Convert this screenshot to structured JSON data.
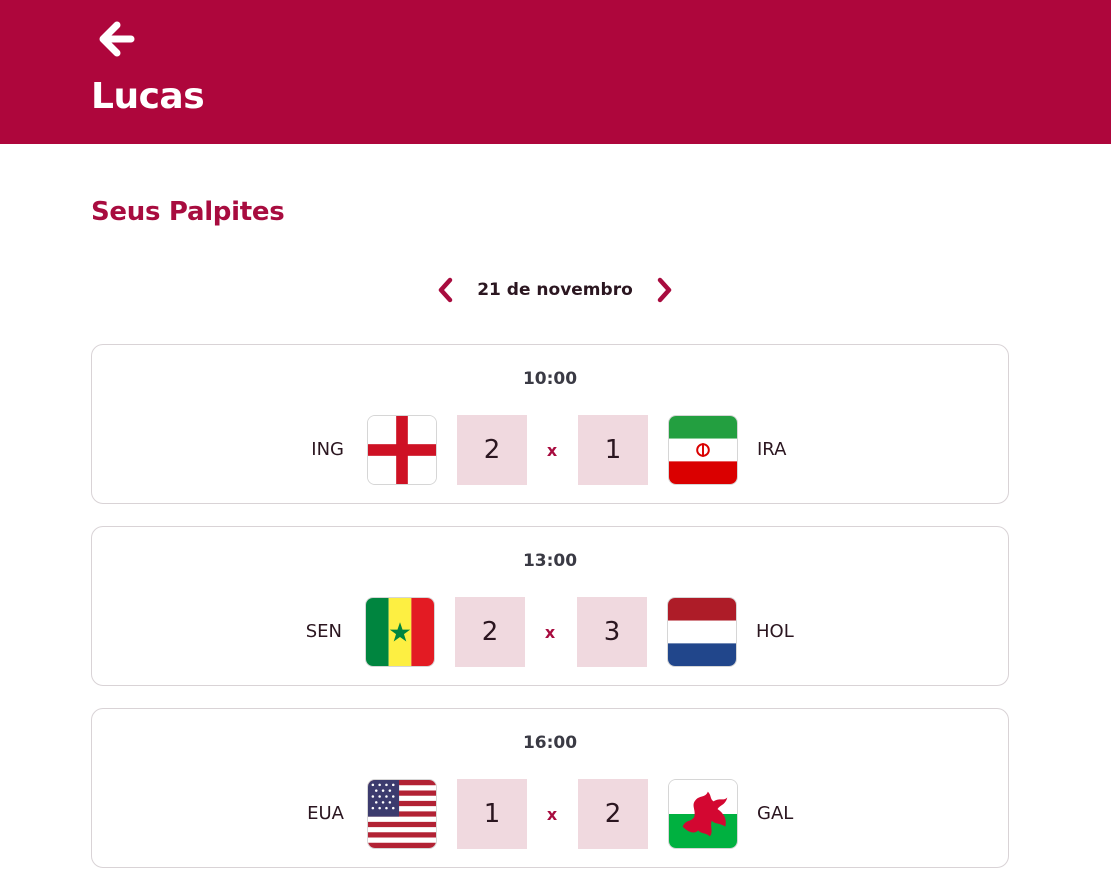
{
  "header": {
    "back_icon": "arrow-left-icon",
    "title": "Lucas"
  },
  "section": {
    "title": "Seus Palpites"
  },
  "date_nav": {
    "prev_icon": "chevron-left-icon",
    "next_icon": "chevron-right-icon",
    "label": "21 de novembro"
  },
  "colors": {
    "brand": "#ae063c",
    "score_bg": "#f0d9df",
    "accent_text": "#a80c3f"
  },
  "matches": [
    {
      "time": "10:00",
      "home": {
        "code": "ING",
        "flag": "england-flag-icon",
        "score": "2"
      },
      "versus": "x",
      "away": {
        "code": "IRA",
        "flag": "iran-flag-icon",
        "score": "1"
      }
    },
    {
      "time": "13:00",
      "home": {
        "code": "SEN",
        "flag": "senegal-flag-icon",
        "score": "2"
      },
      "versus": "x",
      "away": {
        "code": "HOL",
        "flag": "netherlands-flag-icon",
        "score": "3"
      }
    },
    {
      "time": "16:00",
      "home": {
        "code": "EUA",
        "flag": "usa-flag-icon",
        "score": "1"
      },
      "versus": "x",
      "away": {
        "code": "GAL",
        "flag": "wales-flag-icon",
        "score": "2"
      }
    }
  ]
}
